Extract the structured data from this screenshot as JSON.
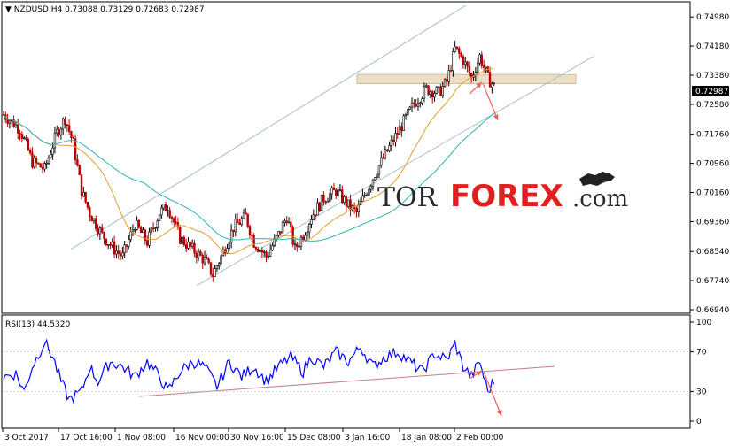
{
  "header": {
    "symbol": "NZDUSD,H4",
    "ohlc": "0.73088 0.73129 0.72683 0.72987"
  },
  "rsi_header": "RSI(13) 44.5320",
  "logo": {
    "part1": "TOR",
    "part2": "FOREX",
    "part3": ".com"
  },
  "current_price_label": "0.72987",
  "colors": {
    "up_candle": "#000000",
    "down_candle": "#b80000",
    "ma_short": "#e0a030",
    "ma_long": "#30b0b0",
    "channel": "#a8c0d0",
    "rsi_line": "#0000ff",
    "rsi_trend": "#c08080",
    "arrow": "#f06060",
    "zone": "#e8dcc0",
    "price_tag": "#000000"
  },
  "chart_data": [
    {
      "type": "line",
      "title": "",
      "y_ticks": [
        "0.74980",
        "0.74180",
        "0.73380",
        "0.72580",
        "0.71760",
        "0.70960",
        "0.70160",
        "0.69360",
        "0.68540",
        "0.67740",
        "0.66940"
      ],
      "ylim": [
        0.6694,
        0.753
      ],
      "x_ticks": [
        "3 Oct 2017",
        "17 Oct 16:00",
        "1 Nov 08:00",
        "16 Nov 00:00",
        "30 Nov 16:00",
        "15 Dec 08:00",
        "3 Jan 16:00",
        "18 Jan 08:00",
        "2 Feb 00:00"
      ],
      "x_count": 240,
      "price_waypoints": [
        [
          0,
          0.723
        ],
        [
          8,
          0.719
        ],
        [
          14,
          0.71
        ],
        [
          20,
          0.708
        ],
        [
          26,
          0.718
        ],
        [
          30,
          0.722
        ],
        [
          34,
          0.715
        ],
        [
          38,
          0.702
        ],
        [
          42,
          0.696
        ],
        [
          48,
          0.69
        ],
        [
          54,
          0.686
        ],
        [
          58,
          0.684
        ],
        [
          64,
          0.693
        ],
        [
          70,
          0.688
        ],
        [
          76,
          0.696
        ],
        [
          80,
          0.698
        ],
        [
          86,
          0.689
        ],
        [
          92,
          0.686
        ],
        [
          98,
          0.683
        ],
        [
          102,
          0.679
        ],
        [
          106,
          0.684
        ],
        [
          112,
          0.692
        ],
        [
          118,
          0.695
        ],
        [
          122,
          0.688
        ],
        [
          128,
          0.684
        ],
        [
          134,
          0.69
        ],
        [
          138,
          0.695
        ],
        [
          142,
          0.686
        ],
        [
          146,
          0.69
        ],
        [
          150,
          0.695
        ],
        [
          156,
          0.7
        ],
        [
          162,
          0.702
        ],
        [
          168,
          0.698
        ],
        [
          172,
          0.696
        ],
        [
          176,
          0.701
        ],
        [
          182,
          0.708
        ],
        [
          188,
          0.714
        ],
        [
          194,
          0.72
        ],
        [
          200,
          0.726
        ],
        [
          206,
          0.73
        ],
        [
          212,
          0.729
        ],
        [
          216,
          0.732
        ],
        [
          220,
          0.741
        ],
        [
          224,
          0.738
        ],
        [
          228,
          0.733
        ],
        [
          232,
          0.739
        ],
        [
          236,
          0.733
        ],
        [
          240,
          0.73
        ]
      ],
      "series": [
        {
          "type": "candlestick"
        },
        {
          "type": "ma_short"
        },
        {
          "type": "ma_long"
        }
      ],
      "resistance_zone": [
        0.7315,
        0.734
      ],
      "channel_upper": [
        [
          0.686,
          0
        ],
        [
          0.753,
          215
        ]
      ],
      "channel_lower": [
        [
          0.676,
          92
        ],
        [
          0.739,
          275
        ]
      ],
      "current_price": 0.72987
    },
    {
      "type": "line",
      "title": "",
      "y_ticks": [
        "100",
        "70",
        "30",
        "0"
      ],
      "ylim": [
        0,
        100
      ],
      "rsi_waypoints": [
        [
          0,
          45
        ],
        [
          6,
          48
        ],
        [
          10,
          30
        ],
        [
          14,
          55
        ],
        [
          20,
          80
        ],
        [
          24,
          65
        ],
        [
          28,
          40
        ],
        [
          32,
          22
        ],
        [
          38,
          30
        ],
        [
          42,
          55
        ],
        [
          46,
          40
        ],
        [
          52,
          60
        ],
        [
          58,
          55
        ],
        [
          64,
          45
        ],
        [
          70,
          60
        ],
        [
          76,
          45
        ],
        [
          80,
          30
        ],
        [
          86,
          50
        ],
        [
          92,
          60
        ],
        [
          98,
          55
        ],
        [
          104,
          35
        ],
        [
          110,
          60
        ],
        [
          116,
          45
        ],
        [
          122,
          55
        ],
        [
          128,
          40
        ],
        [
          134,
          55
        ],
        [
          140,
          65
        ],
        [
          146,
          50
        ],
        [
          150,
          65
        ],
        [
          156,
          55
        ],
        [
          162,
          70
        ],
        [
          168,
          60
        ],
        [
          174,
          75
        ],
        [
          180,
          55
        ],
        [
          186,
          65
        ],
        [
          192,
          70
        ],
        [
          198,
          60
        ],
        [
          204,
          50
        ],
        [
          210,
          68
        ],
        [
          216,
          62
        ],
        [
          220,
          78
        ],
        [
          224,
          55
        ],
        [
          228,
          45
        ],
        [
          232,
          60
        ],
        [
          236,
          30
        ],
        [
          240,
          44
        ]
      ],
      "rsi_trend": [
        [
          28,
          0
        ],
        [
          58,
          245
        ]
      ]
    }
  ]
}
